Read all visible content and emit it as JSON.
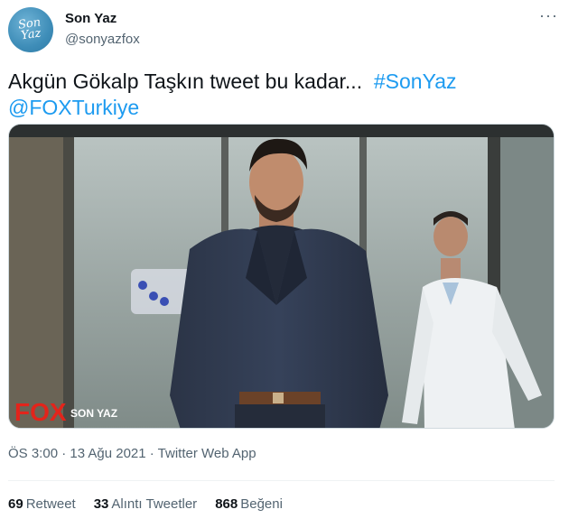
{
  "account": {
    "name": "Son Yaz",
    "handle": "@sonyazfox",
    "avatar_text_1": "Son",
    "avatar_text_2": "Yaz"
  },
  "tweet": {
    "text_main": "Akgün Gökalp Taşkın tweet bu kadar...",
    "hashtag": "#SonYaz",
    "mention": "@FOXTurkiye",
    "timestamp": "ÖS 3:00 · 13 Ağu 2021 · Twitter Web App"
  },
  "media": {
    "channel_logo": "FOX",
    "show_title": "SON YAZ"
  },
  "stats": {
    "retweets_count": "69",
    "retweets_label": "Retweet",
    "quotes_count": "33",
    "quotes_label": "Alıntı Tweetler",
    "likes_count": "868",
    "likes_label": "Beğeni"
  },
  "icons": {
    "more": "more-horizontal-icon"
  },
  "colors": {
    "link": "#1d9bf0",
    "secondary_text": "#536471",
    "fox_red": "#e3241b"
  }
}
